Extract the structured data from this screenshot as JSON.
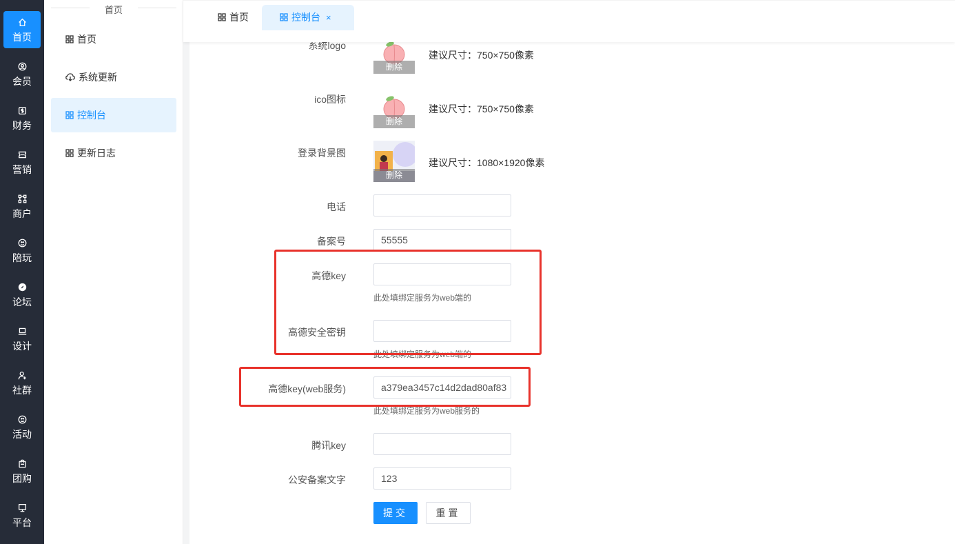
{
  "rail": {
    "items": [
      {
        "label": "首页",
        "icon": "home-icon"
      },
      {
        "label": "会员",
        "icon": "user-circle-icon"
      },
      {
        "label": "财务",
        "icon": "money-icon"
      },
      {
        "label": "营销",
        "icon": "ticket-icon"
      },
      {
        "label": "商户",
        "icon": "nodes-icon"
      },
      {
        "label": "陪玩",
        "icon": "play-circle-icon"
      },
      {
        "label": "论坛",
        "icon": "compass-icon"
      },
      {
        "label": "设计",
        "icon": "laptop-icon"
      },
      {
        "label": "社群",
        "icon": "user-add-icon"
      },
      {
        "label": "活动",
        "icon": "activity-icon"
      },
      {
        "label": "团购",
        "icon": "bag-icon"
      },
      {
        "label": "平台",
        "icon": "monitor-icon"
      }
    ]
  },
  "submenu": {
    "title": "首页",
    "items": [
      {
        "label": "首页",
        "icon": "grid-icon"
      },
      {
        "label": "系统更新",
        "icon": "cloud-download-icon"
      },
      {
        "label": "控制台",
        "icon": "grid-icon"
      },
      {
        "label": "更新日志",
        "icon": "grid-icon"
      }
    ]
  },
  "tabs": {
    "home": "首页",
    "active": "控制台",
    "close": "×"
  },
  "form": {
    "logo_label": "系统logo",
    "logo_hint": "建议尺寸：750×750像素",
    "ico_label": "ico图标",
    "ico_hint": "建议尺寸：750×750像素",
    "bg_label": "登录背景图",
    "bg_hint": "建议尺寸：1080×1920像素",
    "delete_label": "删除",
    "phone_label": "电话",
    "phone_value": "",
    "icp_label": "备案号",
    "icp_value": "55555",
    "amap_key_label": "高德key",
    "amap_key_value": "",
    "amap_key_hint": "此处填绑定服务为web端的",
    "amap_secret_label": "高德安全密钥",
    "amap_secret_value": "",
    "amap_secret_hint": "此处填绑定服务为web端的",
    "amap_web_label": "高德key(web服务)",
    "amap_web_value": "a379ea3457c14d2dad80af83",
    "amap_web_hint": "此处填绑定服务为web服务的",
    "tencent_key_label": "腾讯key",
    "tencent_key_value": "",
    "police_label": "公安备案文字",
    "police_value": "123",
    "submit_label": "提交",
    "reset_label": "重置"
  },
  "colors": {
    "primary": "#1890ff",
    "rail_bg": "#262c38",
    "highlight": "#e8322b"
  }
}
